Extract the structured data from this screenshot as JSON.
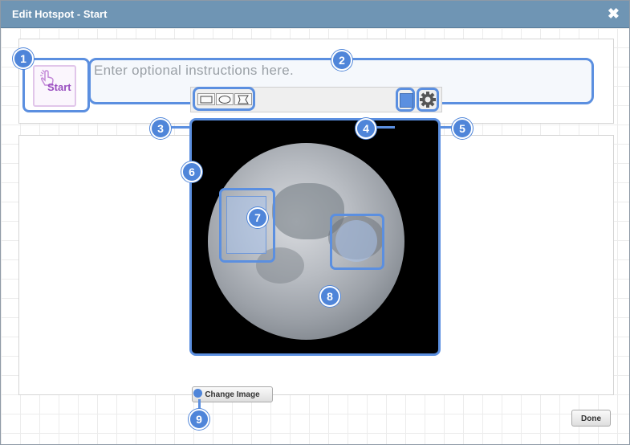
{
  "dialog": {
    "title": "Edit Hotspot - Start"
  },
  "start_icon": {
    "label": "Start"
  },
  "instructions": {
    "placeholder": "Enter optional instructions here."
  },
  "toolbar": {
    "shapes": [
      "rectangle",
      "ellipse",
      "polygon"
    ],
    "hotspot_color": "#5b8fe0"
  },
  "buttons": {
    "change_image": "Change Image",
    "done": "Done"
  },
  "callouts": [
    "1",
    "2",
    "3",
    "4",
    "5",
    "6",
    "7",
    "8",
    "9"
  ],
  "colors": {
    "titlebar": "#6f95b4",
    "accent": "#5b8fe0",
    "start_purple": "#9a4fc0"
  }
}
